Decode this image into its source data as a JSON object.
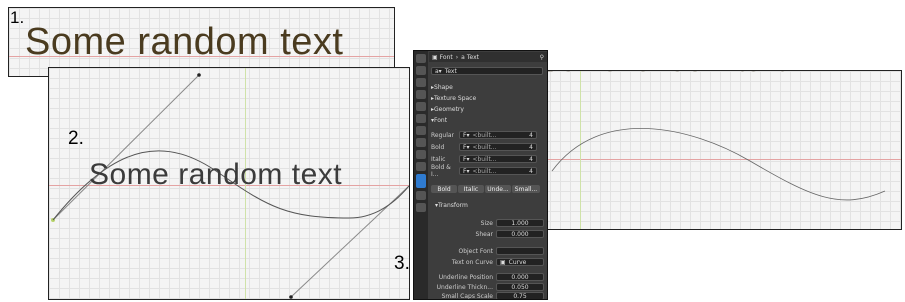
{
  "steps": {
    "one": "1.",
    "two": "2.",
    "three": "3."
  },
  "sample_text": "Some random text",
  "colors": {
    "text_brown": "#4a3b1f",
    "text_dark": "#3b3b3b",
    "accent": "#2f7bd0",
    "axis_red": "#d98080",
    "axis_green": "#a9cf7f"
  },
  "properties": {
    "breadcrumb_font": "Font",
    "breadcrumb_text": "Text",
    "datablock_name": "Text",
    "sections": {
      "shape": "Shape",
      "texture_space": "Texture Space",
      "geometry": "Geometry",
      "font": "Font"
    },
    "font_rows": [
      {
        "label": "Regular",
        "value": "<built...",
        "users": "4"
      },
      {
        "label": "Bold",
        "value": "<built...",
        "users": "4"
      },
      {
        "label": "Italic",
        "value": "<built...",
        "users": "4"
      },
      {
        "label": "Bold & I...",
        "value": "<built...",
        "users": "4"
      }
    ],
    "style_buttons": {
      "bold": "Bold",
      "italic": "Italic",
      "underline": "Unde...",
      "small_caps": "Small..."
    },
    "transform": {
      "header": "Transform",
      "size_label": "Size",
      "size_value": "1.000",
      "shear_label": "Shear",
      "shear_value": "0.000",
      "object_font_label": "Object Font",
      "text_on_curve_label": "Text on Curve",
      "text_on_curve_value": "Curve",
      "underline_position_label": "Underline Position",
      "underline_position_value": "0.000",
      "underline_thickness_label": "Underline Thickn...",
      "underline_thickness_value": "0.050",
      "small_caps_label": "Small Caps Scale",
      "small_caps_value": "0.75"
    }
  }
}
